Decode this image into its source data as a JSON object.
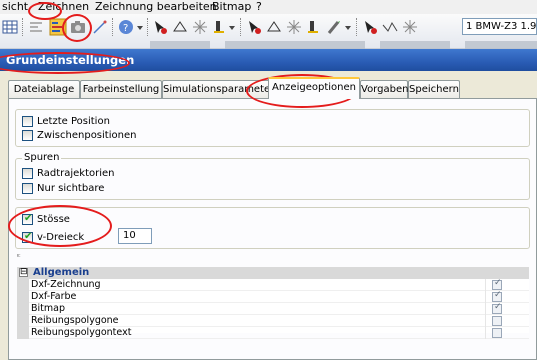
{
  "menubar": {
    "items": [
      "sicht",
      "Zeichnen",
      "Zeichnung bearbeiten",
      "Bitmap",
      "?"
    ]
  },
  "toolbar": {
    "combo_value": "1  BMW-Z3 1.9"
  },
  "dialog": {
    "title": "Grundeinstellungen",
    "tabs": [
      "Dateiablage",
      "Farbeinstellung",
      "Simulationsparameter",
      "Anzeigeoptionen",
      "Vorgaben",
      "Speichern"
    ],
    "active_tab": "Anzeigeoptionen"
  },
  "options": {
    "group1": {
      "items": [
        {
          "label": "Letzte Position",
          "checked": false
        },
        {
          "label": "Zwischenpositionen",
          "checked": false
        }
      ]
    },
    "spuren": {
      "title": "Spuren",
      "items": [
        {
          "label": "Radtrajektorien",
          "checked": false
        },
        {
          "label": "Nur sichtbare",
          "checked": false
        }
      ]
    },
    "group3": {
      "stoesse": {
        "label": "Stösse",
        "checked": true
      },
      "vdreieck": {
        "label": "v-Dreieck",
        "checked": true,
        "value": "10"
      }
    }
  },
  "property_grid": {
    "category": "Allgemein",
    "expander": "⊟",
    "rows": [
      {
        "name": "Dxf-Zeichnung",
        "checked": true
      },
      {
        "name": "Dxf-Farbe",
        "checked": true
      },
      {
        "name": "Bitmap",
        "checked": true
      },
      {
        "name": "Reibungspolygone",
        "checked": false
      },
      {
        "name": "Reibungspolygontext",
        "checked": false
      }
    ]
  },
  "colors": {
    "title_bar": "#2a5cb5",
    "annotation": "#e41c1c",
    "active_tab_accent": "#ffc83c"
  }
}
